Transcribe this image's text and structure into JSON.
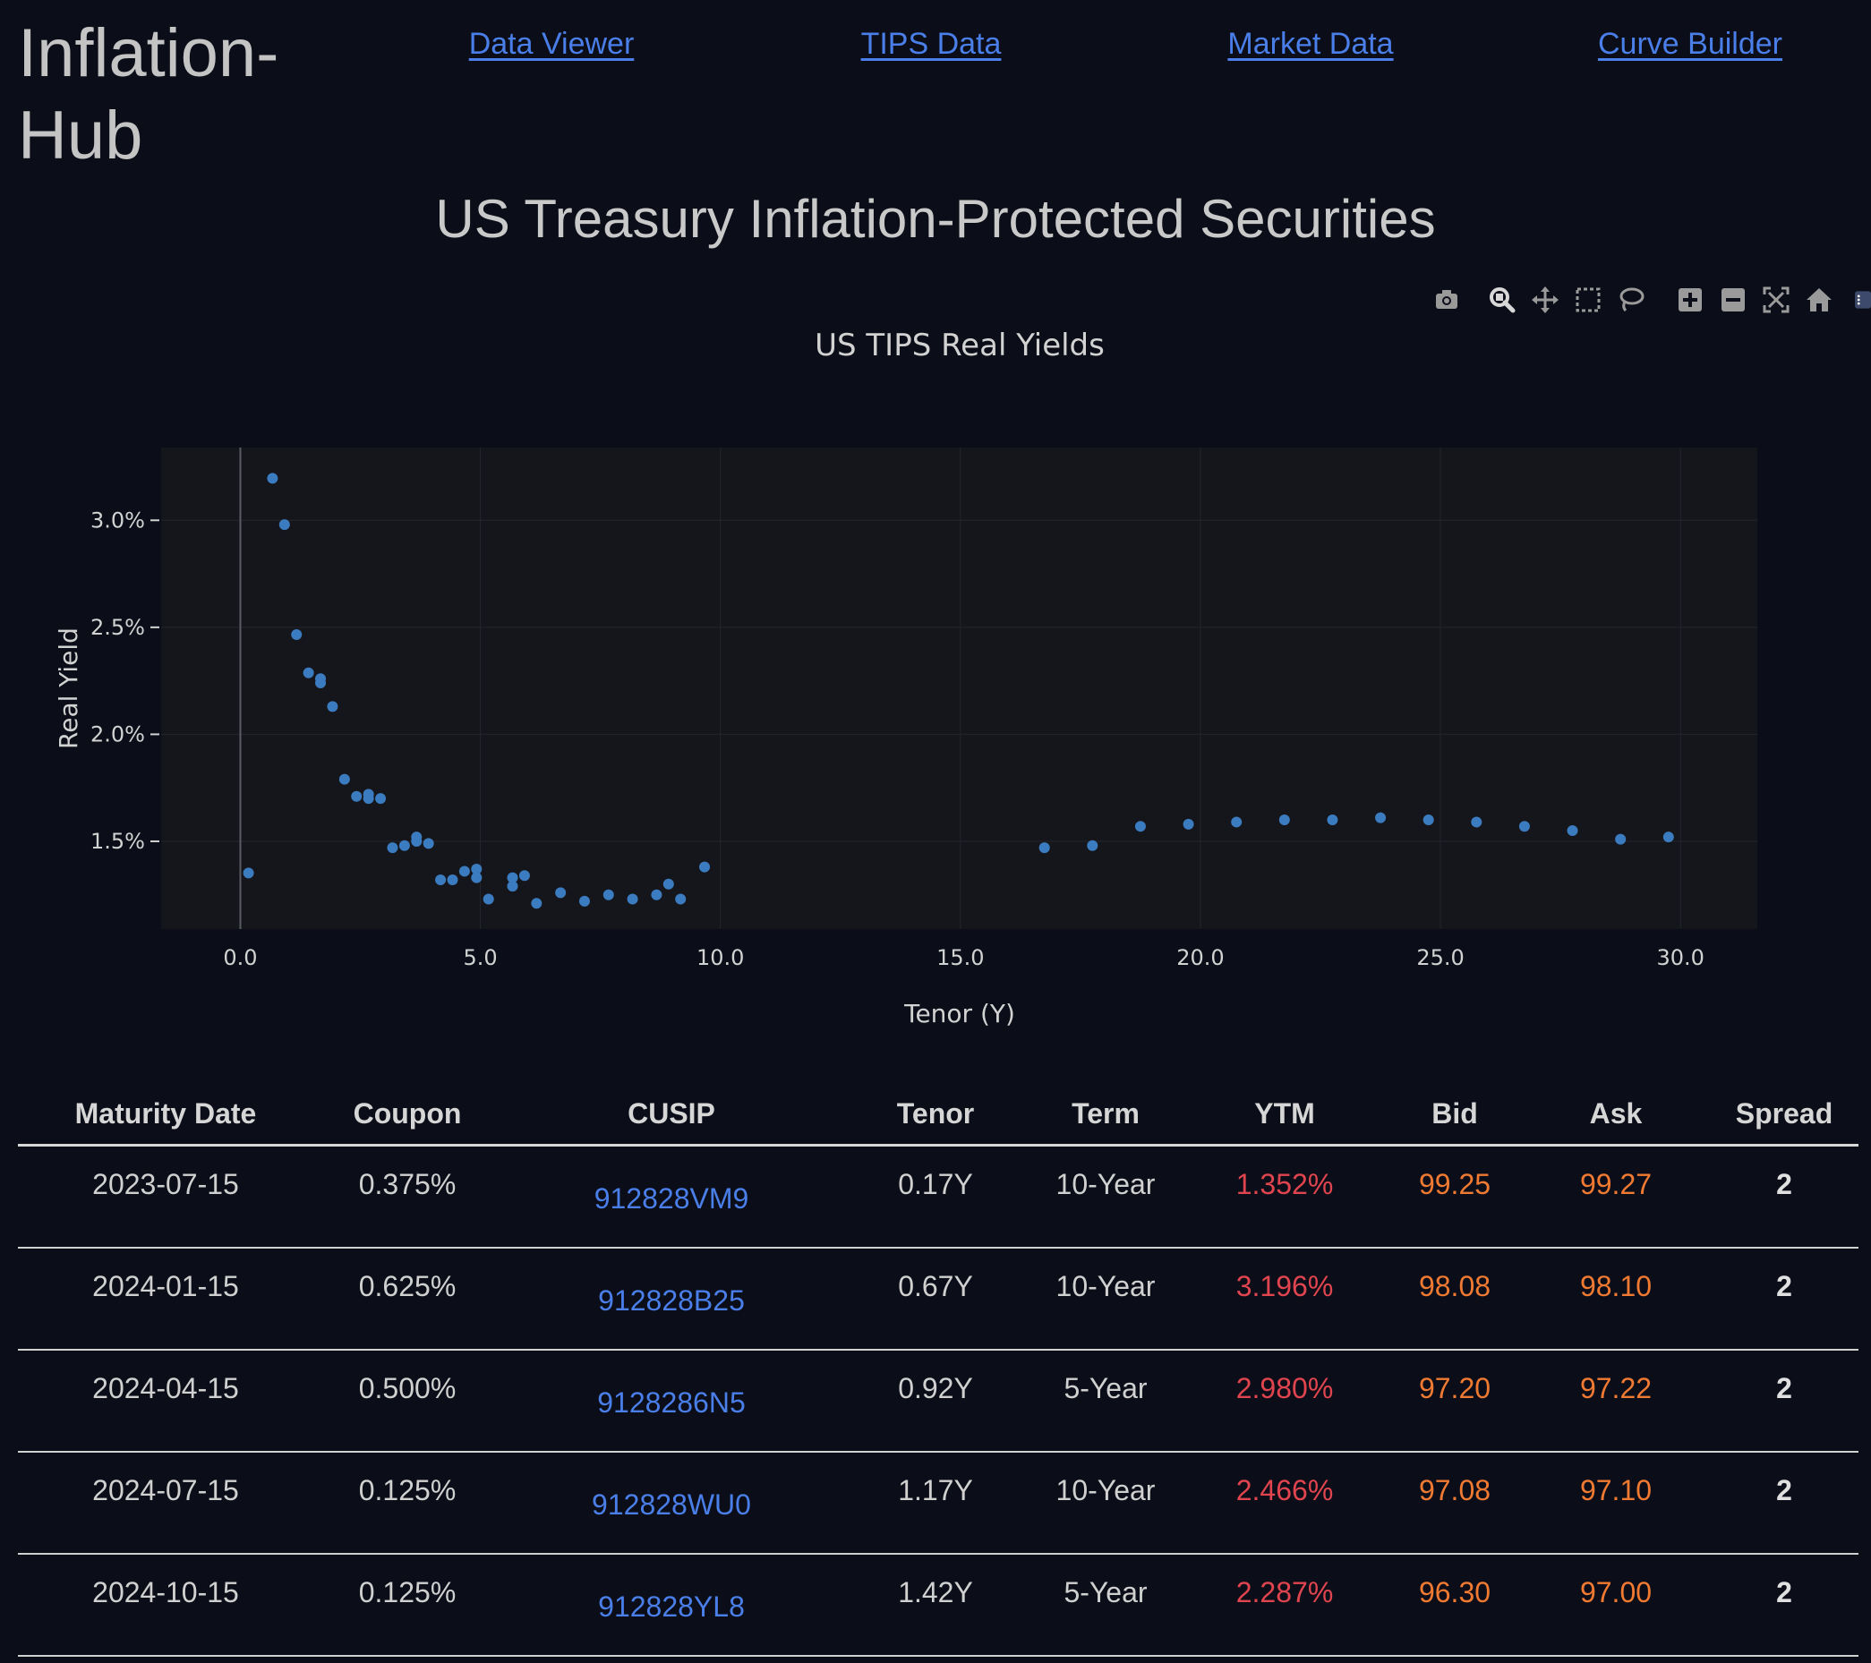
{
  "brand": "Inflation-Hub",
  "nav": [
    {
      "label": "Data Viewer"
    },
    {
      "label": "TIPS Data"
    },
    {
      "label": "Market Data"
    },
    {
      "label": "Curve Builder"
    }
  ],
  "page_title": "US Treasury Inflation-Protected Securities",
  "modebar": [
    "camera-icon",
    "zoom-icon",
    "pan-icon",
    "box-select-icon",
    "lasso-select-icon",
    "zoom-in-icon",
    "zoom-out-icon",
    "autoscale-icon",
    "reset-axes-icon",
    "plotly-logo-icon"
  ],
  "colors": {
    "background": "#0b0e18",
    "plot_bg": "#15161b",
    "marker": "#3b7bbf",
    "link": "#4a7ee8",
    "ytm": "#e0454f",
    "price": "#f07a32"
  },
  "chart_data": {
    "type": "scatter",
    "title": "US TIPS Real Yields",
    "xlabel": "Tenor (Y)",
    "ylabel": "Real Yield",
    "xlim": [
      -1.65,
      31.6
    ],
    "ylim": [
      1.09,
      3.34
    ],
    "xticks": [
      0,
      5,
      10,
      15,
      20,
      25,
      30
    ],
    "xtick_labels": [
      "0.0",
      "5.0",
      "10.0",
      "15.0",
      "20.0",
      "25.0",
      "30.0"
    ],
    "yticks": [
      1.5,
      2.0,
      2.5,
      3.0
    ],
    "ytick_labels": [
      "1.5%",
      "2.0%",
      "2.5%",
      "3.0%"
    ],
    "grid": true,
    "zeroline_x": 0,
    "x": [
      0.17,
      0.67,
      0.92,
      1.17,
      1.42,
      1.67,
      1.67,
      1.92,
      2.17,
      2.42,
      2.67,
      2.67,
      2.92,
      3.17,
      3.42,
      3.67,
      3.67,
      3.92,
      4.17,
      4.42,
      4.67,
      4.92,
      4.92,
      5.17,
      5.67,
      5.67,
      5.92,
      6.17,
      6.67,
      7.17,
      7.67,
      8.17,
      8.67,
      8.92,
      9.17,
      9.67,
      16.75,
      17.75,
      18.75,
      19.75,
      20.75,
      21.75,
      22.75,
      23.75,
      24.75,
      25.75,
      26.75,
      27.75,
      28.75,
      29.75
    ],
    "y": [
      1.352,
      3.196,
      2.98,
      2.466,
      2.287,
      2.26,
      2.24,
      2.13,
      1.79,
      1.71,
      1.72,
      1.7,
      1.7,
      1.47,
      1.48,
      1.52,
      1.5,
      1.49,
      1.32,
      1.32,
      1.36,
      1.37,
      1.33,
      1.23,
      1.33,
      1.29,
      1.34,
      1.21,
      1.26,
      1.22,
      1.25,
      1.23,
      1.25,
      1.3,
      1.23,
      1.38,
      1.47,
      1.48,
      1.57,
      1.58,
      1.59,
      1.6,
      1.6,
      1.61,
      1.6,
      1.59,
      1.57,
      1.55,
      1.51,
      1.52
    ]
  },
  "table": {
    "columns": [
      "Maturity Date",
      "Coupon",
      "CUSIP",
      "Tenor",
      "Term",
      "YTM",
      "Bid",
      "Ask",
      "Spread"
    ],
    "rows": [
      {
        "maturity": "2023-07-15",
        "coupon": "0.375%",
        "cusip": "912828VM9",
        "tenor": "0.17Y",
        "term": "10-Year",
        "ytm": "1.352%",
        "bid": "99.25",
        "ask": "99.27",
        "spread": "2"
      },
      {
        "maturity": "2024-01-15",
        "coupon": "0.625%",
        "cusip": "912828B25",
        "tenor": "0.67Y",
        "term": "10-Year",
        "ytm": "3.196%",
        "bid": "98.08",
        "ask": "98.10",
        "spread": "2"
      },
      {
        "maturity": "2024-04-15",
        "coupon": "0.500%",
        "cusip": "9128286N5",
        "tenor": "0.92Y",
        "term": "5-Year",
        "ytm": "2.980%",
        "bid": "97.20",
        "ask": "97.22",
        "spread": "2"
      },
      {
        "maturity": "2024-07-15",
        "coupon": "0.125%",
        "cusip": "912828WU0",
        "tenor": "1.17Y",
        "term": "10-Year",
        "ytm": "2.466%",
        "bid": "97.08",
        "ask": "97.10",
        "spread": "2"
      },
      {
        "maturity": "2024-10-15",
        "coupon": "0.125%",
        "cusip": "912828YL8",
        "tenor": "1.42Y",
        "term": "5-Year",
        "ytm": "2.287%",
        "bid": "96.30",
        "ask": "97.00",
        "spread": "2"
      }
    ]
  }
}
